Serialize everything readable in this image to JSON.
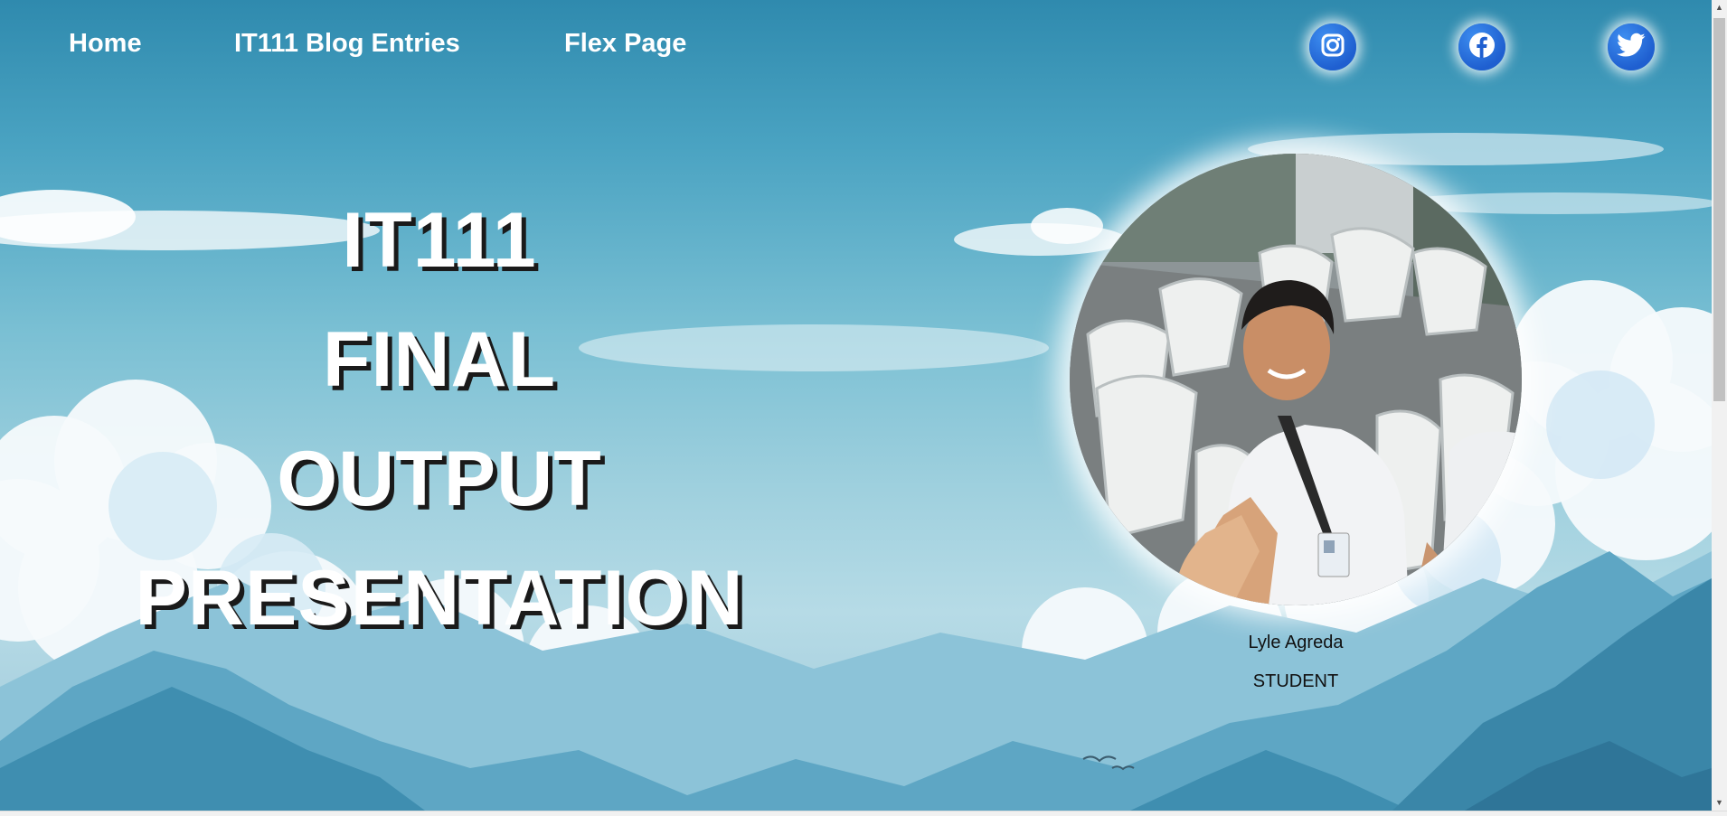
{
  "nav": {
    "links": [
      {
        "label": "Home"
      },
      {
        "label": "IT111 Blog Entries"
      },
      {
        "label": "Flex Page"
      }
    ],
    "social": [
      {
        "icon": "instagram-icon"
      },
      {
        "icon": "facebook-icon"
      },
      {
        "icon": "twitter-icon"
      }
    ]
  },
  "hero": {
    "title_lines": [
      "IT111",
      "FINAL",
      "OUTPUT",
      "PRESENTATION"
    ]
  },
  "profile": {
    "name": "Lyle Agreda",
    "role": "STUDENT"
  },
  "colors": {
    "sky_top": "#2f8aae",
    "sky_bottom": "#b6dbe6",
    "social_blue": "#1f5fd0",
    "mountain": "#3f8eb0"
  }
}
